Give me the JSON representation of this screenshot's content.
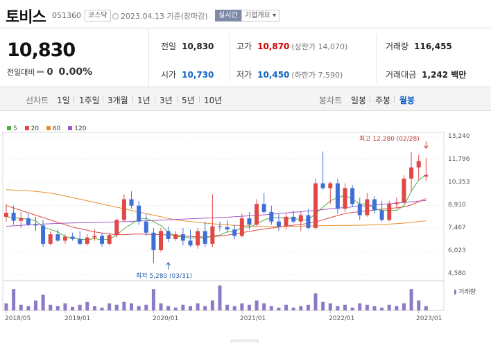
{
  "header": {
    "title": "토비스",
    "code": "051360",
    "market": "코스닥",
    "date": "2023.04.13 기준(장마감)",
    "realtime": "실시간",
    "overview": "기업개요 ▾"
  },
  "summary": {
    "price": "10,830",
    "change_label": "전일대비",
    "change_value": "0",
    "change_rate": "0.00%",
    "prev_close_label": "전일",
    "prev_close": "10,830",
    "high_label": "고가",
    "high": "10,870",
    "upper_limit": "(상한가 14,070)",
    "volume_label": "거래량",
    "volume": "116,455",
    "open_label": "시가",
    "open": "10,730",
    "low_label": "저가",
    "low": "10,450",
    "lower_limit": "(하한가 7,590)",
    "amount_label": "거래대금",
    "amount": "1,242 백만"
  },
  "tabs": {
    "line_label": "선차트",
    "line": [
      "1일",
      "1주일",
      "3개월",
      "1년",
      "3년",
      "5년",
      "10년"
    ],
    "candle_label": "봉차트",
    "candle": [
      "일봉",
      "주봉",
      "월봉"
    ],
    "active": "월봉"
  },
  "colors": {
    "up": "#e04848",
    "down": "#3e6fd6",
    "ma5": "#4caf3e",
    "ma20": "#e04848",
    "ma60": "#e6902a",
    "ma120": "#a259c7",
    "volume": "#8d7ac6"
  },
  "chart_data": {
    "type": "candlestick",
    "legend": [
      "5",
      "20",
      "60",
      "120"
    ],
    "y_ticks": [
      "13,240",
      "11,796",
      "10,353",
      "8,910",
      "7,467",
      "6,023",
      "4,580"
    ],
    "ylim": [
      4580,
      13240
    ],
    "x_labels": [
      "2018/05",
      "2019/01",
      "2020/01",
      "2021/01",
      "2022/01",
      "2023/01"
    ],
    "x_label_months": [
      0,
      8,
      20,
      32,
      44,
      56
    ],
    "annotations": {
      "high": "최고 12,280 (02/28)",
      "low": "최저 5,280 (03/31)",
      "high_month": 57,
      "low_month": 22
    },
    "volume_label": "거래량",
    "candles": [
      {
        "o": 8200,
        "h": 9000,
        "l": 7900,
        "c": 8450
      },
      {
        "o": 8450,
        "h": 8900,
        "l": 7700,
        "c": 7950
      },
      {
        "o": 7950,
        "h": 8500,
        "l": 7500,
        "c": 8100
      },
      {
        "o": 8100,
        "h": 8400,
        "l": 7600,
        "c": 7700
      },
      {
        "o": 7700,
        "h": 8200,
        "l": 7300,
        "c": 7650
      },
      {
        "o": 7650,
        "h": 8000,
        "l": 6300,
        "c": 6500
      },
      {
        "o": 6500,
        "h": 7300,
        "l": 6400,
        "c": 7100
      },
      {
        "o": 7100,
        "h": 7400,
        "l": 6600,
        "c": 6700
      },
      {
        "o": 6700,
        "h": 7100,
        "l": 6500,
        "c": 6950
      },
      {
        "o": 6950,
        "h": 7200,
        "l": 6700,
        "c": 6800
      },
      {
        "o": 6800,
        "h": 7300,
        "l": 6400,
        "c": 6500
      },
      {
        "o": 6500,
        "h": 7100,
        "l": 6400,
        "c": 6900
      },
      {
        "o": 6900,
        "h": 7400,
        "l": 6700,
        "c": 7000
      },
      {
        "o": 7000,
        "h": 7200,
        "l": 6300,
        "c": 6500
      },
      {
        "o": 6500,
        "h": 7200,
        "l": 6400,
        "c": 7050
      },
      {
        "o": 7050,
        "h": 8100,
        "l": 6900,
        "c": 8000
      },
      {
        "o": 8000,
        "h": 9600,
        "l": 7900,
        "c": 9300
      },
      {
        "o": 9300,
        "h": 9800,
        "l": 8700,
        "c": 8900
      },
      {
        "o": 8900,
        "h": 9200,
        "l": 7700,
        "c": 7900
      },
      {
        "o": 7900,
        "h": 8400,
        "l": 7000,
        "c": 7200
      },
      {
        "o": 7200,
        "h": 7500,
        "l": 5280,
        "c": 6100
      },
      {
        "o": 6100,
        "h": 7500,
        "l": 6000,
        "c": 7300
      },
      {
        "o": 7300,
        "h": 7600,
        "l": 6600,
        "c": 6800
      },
      {
        "o": 6800,
        "h": 7300,
        "l": 6700,
        "c": 7100
      },
      {
        "o": 7100,
        "h": 7500,
        "l": 6400,
        "c": 6700
      },
      {
        "o": 6700,
        "h": 7400,
        "l": 6300,
        "c": 6400
      },
      {
        "o": 6400,
        "h": 7500,
        "l": 6200,
        "c": 7300
      },
      {
        "o": 7300,
        "h": 7900,
        "l": 6300,
        "c": 6500
      },
      {
        "o": 6500,
        "h": 9600,
        "l": 6300,
        "c": 7600
      },
      {
        "o": 7600,
        "h": 7900,
        "l": 7300,
        "c": 7550
      },
      {
        "o": 7550,
        "h": 8000,
        "l": 7200,
        "c": 7400
      },
      {
        "o": 7400,
        "h": 7700,
        "l": 6800,
        "c": 7000
      },
      {
        "o": 7000,
        "h": 8400,
        "l": 6900,
        "c": 8100
      },
      {
        "o": 8100,
        "h": 8500,
        "l": 7400,
        "c": 7700
      },
      {
        "o": 7700,
        "h": 9300,
        "l": 7600,
        "c": 9000
      },
      {
        "o": 9000,
        "h": 9700,
        "l": 8400,
        "c": 8500
      },
      {
        "o": 8500,
        "h": 8900,
        "l": 7700,
        "c": 7900
      },
      {
        "o": 7900,
        "h": 8400,
        "l": 7300,
        "c": 7600
      },
      {
        "o": 7600,
        "h": 8400,
        "l": 7400,
        "c": 8200
      },
      {
        "o": 8200,
        "h": 8600,
        "l": 7800,
        "c": 7900
      },
      {
        "o": 7900,
        "h": 8500,
        "l": 7300,
        "c": 8300
      },
      {
        "o": 8300,
        "h": 8700,
        "l": 7400,
        "c": 7500
      },
      {
        "o": 7500,
        "h": 10600,
        "l": 7400,
        "c": 10300
      },
      {
        "o": 10300,
        "h": 12300,
        "l": 9900,
        "c": 10000
      },
      {
        "o": 10000,
        "h": 10400,
        "l": 9000,
        "c": 10300
      },
      {
        "o": 10300,
        "h": 10600,
        "l": 8400,
        "c": 8700
      },
      {
        "o": 8700,
        "h": 10300,
        "l": 8500,
        "c": 10000
      },
      {
        "o": 10000,
        "h": 10200,
        "l": 8800,
        "c": 9000
      },
      {
        "o": 9000,
        "h": 9400,
        "l": 8000,
        "c": 8300
      },
      {
        "o": 8300,
        "h": 9700,
        "l": 8200,
        "c": 9300
      },
      {
        "o": 9300,
        "h": 9500,
        "l": 8400,
        "c": 8600
      },
      {
        "o": 8600,
        "h": 9200,
        "l": 7900,
        "c": 8000
      },
      {
        "o": 8000,
        "h": 9200,
        "l": 7900,
        "c": 9000
      },
      {
        "o": 9000,
        "h": 9400,
        "l": 8700,
        "c": 9100
      },
      {
        "o": 9100,
        "h": 10800,
        "l": 9000,
        "c": 10600
      },
      {
        "o": 10600,
        "h": 12280,
        "l": 9800,
        "c": 11300
      },
      {
        "o": 11300,
        "h": 12100,
        "l": 10500,
        "c": 11700
      },
      {
        "o": 10730,
        "h": 11900,
        "l": 10450,
        "c": 10830
      }
    ],
    "ma5": [
      8200,
      8150,
      8100,
      8050,
      7950,
      7550,
      7400,
      7250,
      6950,
      6850,
      6800,
      6750,
      6830,
      6750,
      6800,
      7050,
      7450,
      7750,
      8050,
      8100,
      7900,
      7650,
      7250,
      6950,
      6950,
      6850,
      6900,
      6850,
      7000,
      7050,
      7250,
      7250,
      7550,
      7550,
      7750,
      8000,
      8150,
      8150,
      8100,
      8100,
      8000,
      8000,
      8400,
      8800,
      9200,
      9400,
      9550,
      9300,
      9000,
      9000,
      8700,
      8600,
      8600,
      8600,
      8900,
      9800,
      10500,
      10850
    ],
    "ma20": [
      8900,
      8750,
      8600,
      8450,
      8300,
      8150,
      8000,
      7850,
      7700,
      7550,
      7450,
      7350,
      7250,
      7180,
      7120,
      7080,
      7080,
      7100,
      7120,
      7100,
      7090,
      7080,
      7060,
      7040,
      7000,
      6960,
      6940,
      6930,
      6950,
      6990,
      7050,
      7120,
      7200,
      7280,
      7360,
      7430,
      7490,
      7550,
      7610,
      7670,
      7720,
      7780,
      7880,
      8000,
      8150,
      8280,
      8400,
      8470,
      8530,
      8580,
      8620,
      8680,
      8720,
      8760,
      8820,
      8950,
      9150,
      9350
    ],
    "ma60": [
      9900,
      9880,
      9860,
      9830,
      9790,
      9740,
      9680,
      9600,
      9500,
      9400,
      9300,
      9200,
      9100,
      9000,
      8900,
      8800,
      8700,
      8600,
      8500,
      8400,
      8300,
      8200,
      8100,
      8000,
      7950,
      7900,
      7850,
      7800,
      7760,
      7720,
      7690,
      7660,
      7640,
      7620,
      7600,
      7590,
      7580,
      7580,
      7590,
      7600,
      7610,
      7620,
      7630,
      7640,
      7650,
      7660,
      7660,
      7660,
      7670,
      7680,
      7690,
      7710,
      7740,
      7770,
      7800,
      7850,
      7900,
      7950
    ],
    "ma120": [
      7600,
      7630,
      7660,
      7690,
      7720,
      7740,
      7760,
      7780,
      7800,
      7810,
      7820,
      7830,
      7840,
      7850,
      7860,
      7870,
      7890,
      7910,
      7930,
      7950,
      7970,
      7990,
      8010,
      8030,
      8050,
      8070,
      8090,
      8110,
      8130,
      8150,
      8170,
      8200,
      8230,
      8260,
      8290,
      8320,
      8360,
      8400,
      8440,
      8480,
      8520,
      8560,
      8600,
      8650,
      8700,
      8740,
      8780,
      8820,
      8860,
      8900,
      8940,
      8980,
      9020,
      9060,
      9100,
      9140,
      9180,
      9220
    ],
    "volumes": [
      10,
      30,
      8,
      6,
      14,
      22,
      8,
      6,
      10,
      5,
      8,
      12,
      6,
      4,
      10,
      8,
      12,
      10,
      6,
      8,
      30,
      10,
      6,
      4,
      8,
      6,
      10,
      6,
      14,
      35,
      8,
      6,
      10,
      8,
      14,
      10,
      6,
      4,
      8,
      4,
      6,
      8,
      24,
      12,
      10,
      6,
      8,
      4,
      10,
      8,
      6,
      4,
      8,
      6,
      10,
      30,
      14,
      6
    ]
  }
}
